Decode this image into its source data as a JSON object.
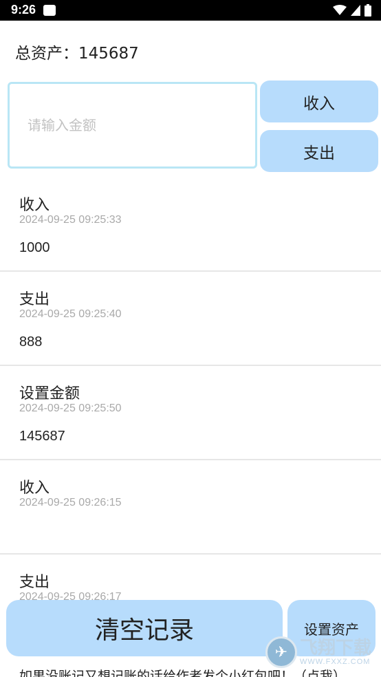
{
  "status_bar": {
    "time": "9:26",
    "icons": [
      "wifi-icon",
      "signal-icon",
      "battery-icon"
    ]
  },
  "total_assets": "总资产：145687",
  "input": {
    "placeholder": "请输入金额",
    "value": ""
  },
  "buttons": {
    "income": "收入",
    "expense": "支出",
    "clear": "清空记录",
    "set_assets": "设置资产"
  },
  "records": [
    {
      "type": "收入",
      "time": "2024-09-25 09:25:33",
      "amount": "1000"
    },
    {
      "type": "支出",
      "time": "2024-09-25 09:25:40",
      "amount": "888"
    },
    {
      "type": "设置金额",
      "time": "2024-09-25 09:25:50",
      "amount": "145687"
    },
    {
      "type": "收入",
      "time": "2024-09-25 09:26:15",
      "amount": ""
    },
    {
      "type": "支出",
      "time": "2024-09-25 09:26:17",
      "amount": ""
    }
  ],
  "footer_link": "如果没账记又想记账的话给作者发个小红包吧！（点我）",
  "watermark": {
    "title": "飞翔下载",
    "url": "WWW.FXXZ.COM"
  },
  "colors": {
    "button_bg": "#b7dcfc",
    "input_border": "#b9e6f5",
    "secondary_text": "#a9a9a9"
  }
}
